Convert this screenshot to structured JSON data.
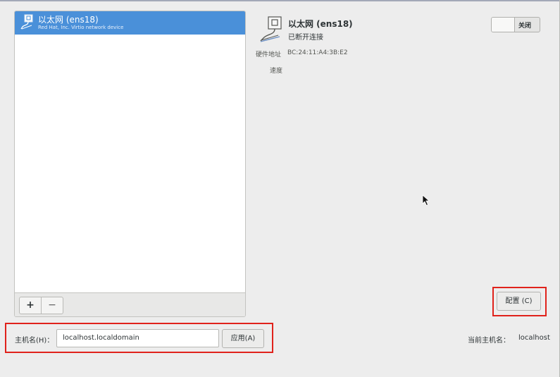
{
  "device_list": {
    "items": [
      {
        "name": "以太网 (ens18)",
        "description": "Red Hat, Inc. Virtio network device",
        "icon": "ethernet-icon",
        "selected": true
      }
    ],
    "add_label": "+",
    "remove_label": "−"
  },
  "details": {
    "icon": "ethernet-icon",
    "title": "以太网 (ens18)",
    "status": "已断开连接",
    "hardware_address_label": "硬件地址",
    "hardware_address_value": "BC:24:11:A4:3B:E2",
    "speed_label": "速度",
    "toggle": {
      "state_label": "关闭",
      "on": false
    },
    "configure_label": "配置 (C)"
  },
  "hostname": {
    "label": "主机名(H)：",
    "value": "localhost.localdomain",
    "apply_label": "应用(A)",
    "current_label": "当前主机名：",
    "current_value": "localhost"
  },
  "colors": {
    "selection": "#4a90d9",
    "highlight_box": "#e0221b",
    "background": "#ededed"
  }
}
